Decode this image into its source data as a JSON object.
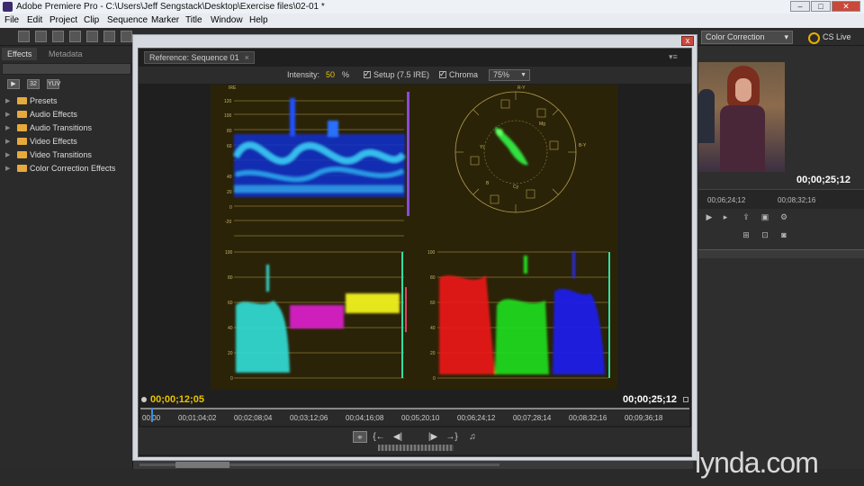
{
  "window": {
    "title": "Adobe Premiere Pro - C:\\Users\\Jeff Sengstack\\Desktop\\Exercise files\\02-01 *",
    "minimize": "–",
    "maximize": "□",
    "close": "✕"
  },
  "menu": [
    "File",
    "Edit",
    "Project",
    "Clip",
    "Sequence",
    "Marker",
    "Title",
    "Window",
    "Help"
  ],
  "workspace": {
    "label": "Color Correction",
    "cs_live": "CS Live"
  },
  "left_panel": {
    "tabs": [
      "Effects",
      "Metadata"
    ],
    "buttons": [
      "▶",
      "32",
      "YUV"
    ],
    "folders": [
      "Presets",
      "Audio Effects",
      "Audio Transitions",
      "Video Effects",
      "Video Transitions",
      "Color Correction Effects"
    ]
  },
  "reference": {
    "tab_label": "Reference: Sequence 01",
    "tab_close": "×",
    "intensity_label": "Intensity:",
    "intensity_value": "50",
    "intensity_unit": "%",
    "setup_label": "Setup (7.5 IRE)",
    "chroma_label": "Chroma",
    "zoom": "75%",
    "timecode_left": "00;00;12;05",
    "timecode_right": "00;00;25;12",
    "ruler_ticks": [
      "00;00",
      "00;01;04;02",
      "00;02;08;04",
      "00;03;12;06",
      "00;04;16;08",
      "00;05;20;10",
      "00;06;24;12",
      "00;07;28;14",
      "00;08;32;16",
      "00;09;36;18"
    ],
    "transport": [
      "⌖",
      "{←",
      "◀|",
      "|▶",
      "→}",
      "♫"
    ]
  },
  "scopes": {
    "waveform_ire": [
      "IRE",
      "120",
      "100",
      "80",
      "60",
      "40",
      "20",
      "0",
      "-20"
    ],
    "rgb_scale": [
      "100",
      "80",
      "60",
      "40",
      "20",
      "0"
    ],
    "vector_labels": [
      "R-Y",
      "B-Y",
      "Mg",
      "YL",
      "Cy",
      "B"
    ]
  },
  "right_panel": {
    "timecode": "00;00;25;12",
    "ruler_ticks": [
      "00;06;24;12",
      "00;08;32;16"
    ]
  },
  "watermark": "lynda.com"
}
